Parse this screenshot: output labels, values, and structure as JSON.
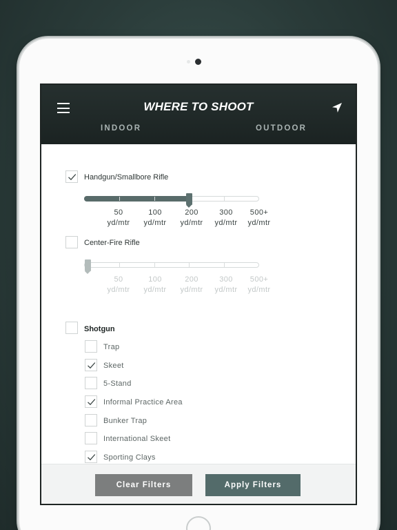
{
  "header": {
    "title": "WHERE TO SHOOT",
    "tabs": [
      {
        "label": "INDOOR"
      },
      {
        "label": "OUTDOOR"
      }
    ],
    "menu_icon": "hamburger-menu-icon",
    "location_icon": "location-arrow-icon"
  },
  "filters": {
    "handgun": {
      "label": "Handgun/Smallbore Rifle",
      "checked": true,
      "slider_value_index": 2,
      "distances": [
        {
          "num": "50",
          "unit": "yd/mtr"
        },
        {
          "num": "100",
          "unit": "yd/mtr"
        },
        {
          "num": "200",
          "unit": "yd/mtr"
        },
        {
          "num": "300",
          "unit": "yd/mtr"
        },
        {
          "num": "500+",
          "unit": "yd/mtr"
        }
      ]
    },
    "centerfire": {
      "label": "Center-Fire Rifle",
      "checked": false,
      "slider_value_index": 0,
      "distances": [
        {
          "num": "50",
          "unit": "yd/mtr"
        },
        {
          "num": "100",
          "unit": "yd/mtr"
        },
        {
          "num": "200",
          "unit": "yd/mtr"
        },
        {
          "num": "300",
          "unit": "yd/mtr"
        },
        {
          "num": "500+",
          "unit": "yd/mtr"
        }
      ]
    },
    "shotgun": {
      "label": "Shotgun",
      "checked": false,
      "options": [
        {
          "label": "Trap",
          "checked": false
        },
        {
          "label": "Skeet",
          "checked": true
        },
        {
          "label": "5-Stand",
          "checked": false
        },
        {
          "label": "Informal Practice Area",
          "checked": true
        },
        {
          "label": "Bunker Trap",
          "checked": false
        },
        {
          "label": "International Skeet",
          "checked": false
        },
        {
          "label": "Sporting Clays",
          "checked": true
        }
      ]
    }
  },
  "footer": {
    "clear_label": "Clear Filters",
    "apply_label": "Apply Filters"
  },
  "colors": {
    "header_bg": "#1f2827",
    "accent": "#536b6a",
    "clear_button": "#7c7e7e"
  }
}
